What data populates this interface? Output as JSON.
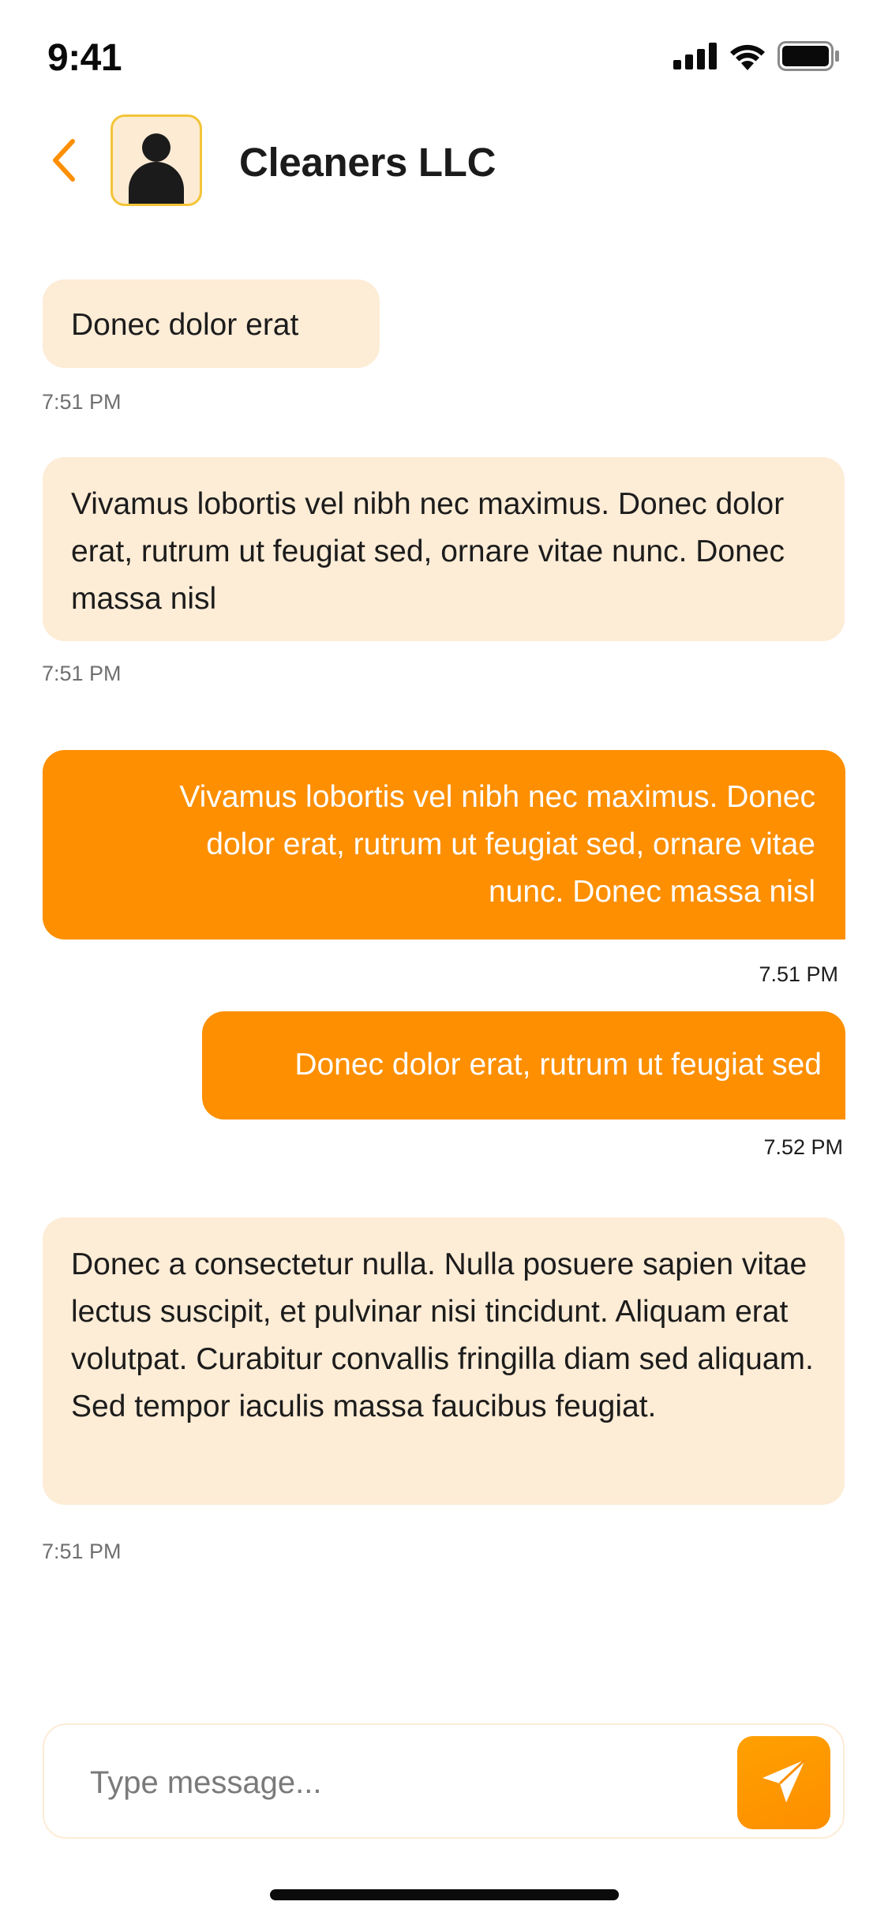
{
  "status_bar": {
    "time": "9:41",
    "icons": [
      "cellular-signal-icon",
      "wifi-icon",
      "battery-icon"
    ]
  },
  "header": {
    "back_icon": "chevron-left-icon",
    "contact_name": "Cleaners LLC",
    "avatar_icon": "person-silhouette-icon"
  },
  "messages": [
    {
      "direction": "incoming",
      "text": "Donec dolor erat",
      "time": "7:51 PM"
    },
    {
      "direction": "incoming",
      "text": "Vivamus lobortis vel nibh nec maximus. Donec dolor erat, rutrum ut feugiat sed, ornare vitae nunc. Donec massa nisl",
      "time": "7:51 PM"
    },
    {
      "direction": "outgoing",
      "text": "Vivamus lobortis vel nibh nec maximus. Donec dolor erat, rutrum ut feugiat sed, ornare vitae nunc. Donec massa nisl",
      "time": "7.51 PM"
    },
    {
      "direction": "outgoing",
      "text": "Donec dolor erat, rutrum ut feugiat sed",
      "time": "7.52 PM"
    },
    {
      "direction": "incoming",
      "text": "Donec a consectetur nulla. Nulla posuere sapien vitae lectus suscipit, et pulvinar nisi tincidunt. Aliquam erat volutpat. Curabitur convallis fringilla diam sed aliquam. Sed tempor iaculis massa faucibus feugiat.",
      "time": "7:51 PM"
    }
  ],
  "composer": {
    "placeholder": "Type message...",
    "value": "",
    "send_icon": "paper-plane-icon"
  },
  "colors": {
    "accent": "#FD8F00",
    "incoming_bubble": "#FDECD6",
    "avatar_border": "#F3C437"
  }
}
